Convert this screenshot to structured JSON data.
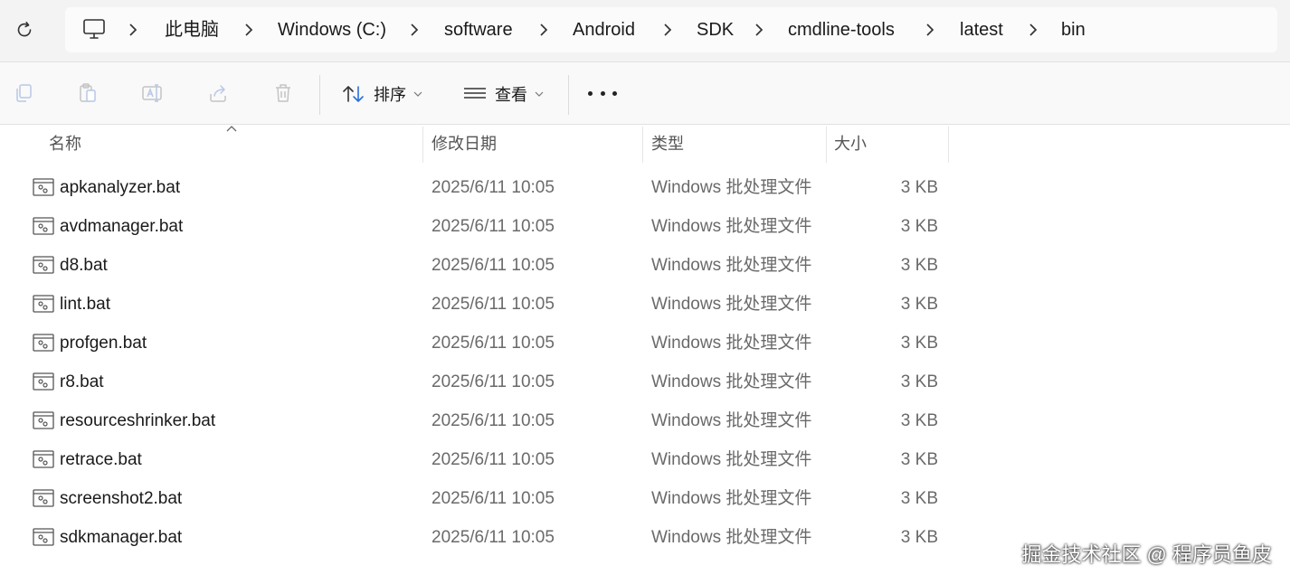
{
  "breadcrumb": [
    "此电脑",
    "Windows (C:)",
    "software",
    "Android",
    "SDK",
    "cmdline-tools",
    "latest",
    "bin"
  ],
  "toolbar": {
    "sort_label": "排序",
    "view_label": "查看"
  },
  "columns": {
    "name": "名称",
    "date": "修改日期",
    "type": "类型",
    "size": "大小"
  },
  "files": [
    {
      "name": "apkanalyzer.bat",
      "date": "2025/6/11 10:05",
      "type": "Windows 批处理文件",
      "size": "3 KB"
    },
    {
      "name": "avdmanager.bat",
      "date": "2025/6/11 10:05",
      "type": "Windows 批处理文件",
      "size": "3 KB"
    },
    {
      "name": "d8.bat",
      "date": "2025/6/11 10:05",
      "type": "Windows 批处理文件",
      "size": "3 KB"
    },
    {
      "name": "lint.bat",
      "date": "2025/6/11 10:05",
      "type": "Windows 批处理文件",
      "size": "3 KB"
    },
    {
      "name": "profgen.bat",
      "date": "2025/6/11 10:05",
      "type": "Windows 批处理文件",
      "size": "3 KB"
    },
    {
      "name": "r8.bat",
      "date": "2025/6/11 10:05",
      "type": "Windows 批处理文件",
      "size": "3 KB"
    },
    {
      "name": "resourceshrinker.bat",
      "date": "2025/6/11 10:05",
      "type": "Windows 批处理文件",
      "size": "3 KB"
    },
    {
      "name": "retrace.bat",
      "date": "2025/6/11 10:05",
      "type": "Windows 批处理文件",
      "size": "3 KB"
    },
    {
      "name": "screenshot2.bat",
      "date": "2025/6/11 10:05",
      "type": "Windows 批处理文件",
      "size": "3 KB"
    },
    {
      "name": "sdkmanager.bat",
      "date": "2025/6/11 10:05",
      "type": "Windows 批处理文件",
      "size": "3 KB"
    }
  ],
  "watermark": "掘金技术社区 @ 程序员鱼皮"
}
